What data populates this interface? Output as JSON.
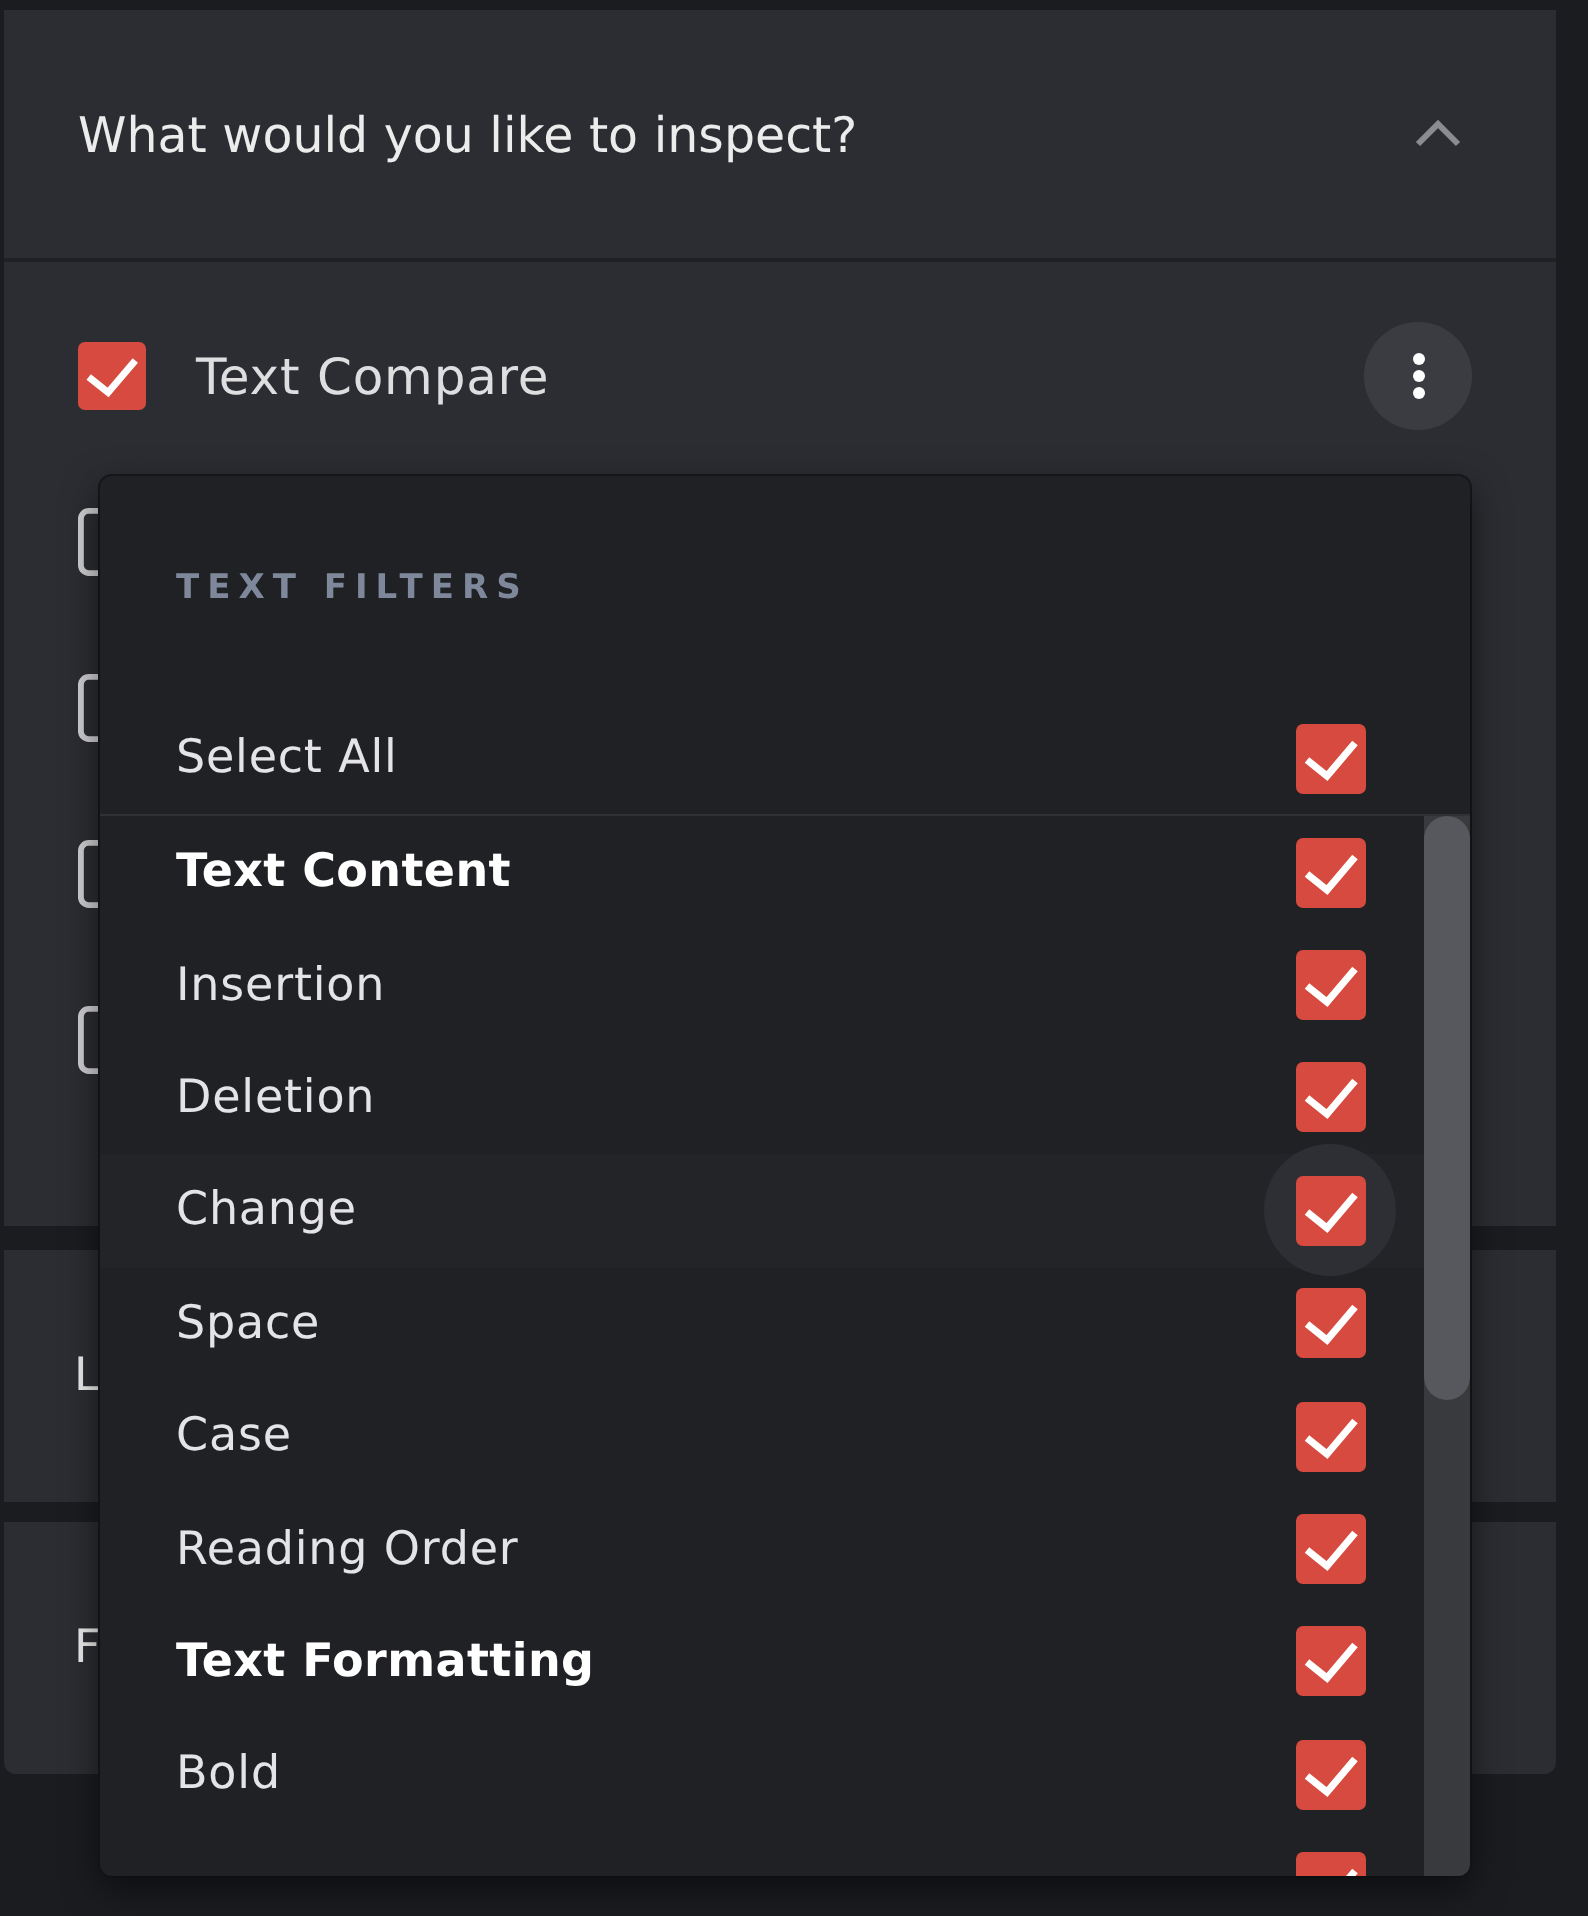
{
  "inspect_panel": {
    "title": "What would you like to inspect?",
    "expanded": true,
    "options": [
      {
        "label": "Text Compare",
        "checked": true
      },
      {
        "checked": false
      },
      {
        "checked": false
      },
      {
        "checked": false
      },
      {
        "checked": false
      }
    ]
  },
  "collapsed_panels": [
    {
      "title": "L"
    },
    {
      "title": "F"
    }
  ],
  "text_filters_menu": {
    "title": "TEXT FILTERS",
    "select_all": {
      "label": "Select All",
      "checked": true
    },
    "items": [
      {
        "kind": "group",
        "label": "Text Content",
        "checked": true,
        "highlighted": false
      },
      {
        "kind": "option",
        "label": "Insertion",
        "checked": true,
        "highlighted": false
      },
      {
        "kind": "option",
        "label": "Deletion",
        "checked": true,
        "highlighted": false
      },
      {
        "kind": "option",
        "label": "Change",
        "checked": true,
        "highlighted": true
      },
      {
        "kind": "option",
        "label": "Space",
        "checked": true,
        "highlighted": false
      },
      {
        "kind": "option",
        "label": "Case",
        "checked": true,
        "highlighted": false
      },
      {
        "kind": "option",
        "label": "Reading Order",
        "checked": true,
        "highlighted": false
      },
      {
        "kind": "group",
        "label": "Text Formatting",
        "checked": true,
        "highlighted": false
      },
      {
        "kind": "option",
        "label": "Bold",
        "checked": true,
        "highlighted": false
      },
      {
        "kind": "option",
        "checked": true,
        "highlighted": false
      }
    ]
  }
}
